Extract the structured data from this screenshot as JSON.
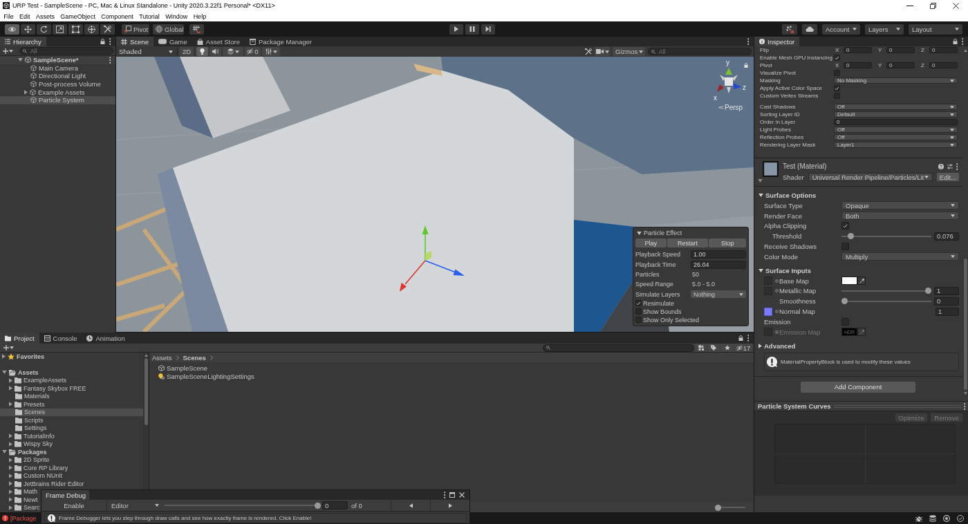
{
  "window": {
    "title": "URP Test - SampleScene - PC, Mac & Linux Standalone - Unity 2020.3.22f1 Personal* <DX11>"
  },
  "menu": [
    "File",
    "Edit",
    "Assets",
    "GameObject",
    "Component",
    "Tutorial",
    "Window",
    "Help"
  ],
  "toolbar": {
    "tools": [
      {
        "kind": "view",
        "selected": true
      },
      {
        "kind": "move",
        "selected": false
      },
      {
        "kind": "rotate",
        "selected": false
      },
      {
        "kind": "scale",
        "selected": false
      },
      {
        "kind": "rect",
        "selected": false
      },
      {
        "kind": "transform",
        "selected": false
      },
      {
        "kind": "custom",
        "selected": false
      }
    ],
    "handle_position": "Pivot",
    "handle_rotation": "Global",
    "account": "Account",
    "layers": "Layers",
    "layout": "Layout"
  },
  "hierarchy": {
    "tab": "Hierarchy",
    "search": {
      "placeholder": "All"
    },
    "items": [
      {
        "name": "SampleScene*",
        "kind": "scene",
        "expanded": true,
        "selected": false,
        "children": [
          {
            "name": "Main Camera",
            "kind": "object",
            "selected": false
          },
          {
            "name": "Directional Light",
            "kind": "object",
            "selected": false
          },
          {
            "name": "Post-process Volume",
            "kind": "object",
            "selected": false
          },
          {
            "name": "Example Assets",
            "kind": "object",
            "expanded": false,
            "selected": false
          },
          {
            "name": "Particle System",
            "kind": "object",
            "selected": true
          }
        ]
      }
    ]
  },
  "scene_view": {
    "tabs": [
      {
        "label": "Scene",
        "kind": "scene",
        "selected": true
      },
      {
        "label": "Game",
        "kind": "game",
        "selected": false
      },
      {
        "label": "Asset Store",
        "kind": "store",
        "selected": false
      },
      {
        "label": "Package Manager",
        "kind": "packages",
        "selected": false
      }
    ],
    "shading": "Shaded",
    "mode_2d": "2D",
    "toggles": [
      {
        "kind": "lighting",
        "on": true
      },
      {
        "kind": "audio",
        "on": false
      },
      {
        "kind": "effects",
        "on": false
      }
    ],
    "hidden_count": "0",
    "gizmos": "Gizmos",
    "search": {
      "placeholder": "All"
    },
    "orientation": {
      "y_label": "y",
      "x_label": "x",
      "z_label": "z",
      "projection": "Persp"
    },
    "particle_effect": {
      "title": "Particle Effect",
      "expanded": true,
      "buttons": [
        "Play",
        "Restart",
        "Stop"
      ],
      "fields": [
        {
          "kind": "input",
          "label": "Playback Speed",
          "value": "1.00"
        },
        {
          "kind": "input",
          "label": "Playback Time",
          "value": "26.04"
        },
        {
          "kind": "text",
          "label": "Particles",
          "value": "50"
        },
        {
          "kind": "text",
          "label": "Speed Range",
          "value": "5.0 - 5.0"
        },
        {
          "kind": "dropdown",
          "label": "Simulate Layers",
          "value": "Nothing"
        }
      ],
      "options": [
        {
          "label": "Resimulate",
          "checked": true
        },
        {
          "label": "Show Bounds",
          "checked": false
        },
        {
          "label": "Show Only Selected",
          "checked": false
        }
      ]
    }
  },
  "inspector": {
    "tab": "Inspector",
    "sections": [
      {
        "rows": [
          {
            "kind": "vector",
            "label": "Flip",
            "axes": [
              {
                "axis": "X",
                "value": "0"
              },
              {
                "axis": "Y",
                "value": "0"
              },
              {
                "axis": "Z",
                "value": "0"
              }
            ]
          },
          {
            "kind": "checkbox",
            "label": "Enable Mesh GPU Instancing",
            "checked": true
          },
          {
            "kind": "vector",
            "label": "Pivot",
            "axes": [
              {
                "axis": "X",
                "value": "0"
              },
              {
                "axis": "Y",
                "value": "0"
              },
              {
                "axis": "Z",
                "value": "0"
              }
            ]
          },
          {
            "kind": "checkbox",
            "label": "Visualize Pivot",
            "checked": false
          },
          {
            "kind": "dropdown",
            "label": "Masking",
            "value": "No Masking"
          },
          {
            "kind": "checkbox",
            "label": "Apply Active Color Space",
            "checked": true
          },
          {
            "kind": "checkbox",
            "label": "Custom Vertex Streams",
            "checked": false
          }
        ]
      },
      {
        "rows": [
          {
            "kind": "dropdown",
            "label": "Cast Shadows",
            "value": "Off"
          },
          {
            "kind": "dropdown",
            "label": "Sorting Layer ID",
            "value": "Default"
          },
          {
            "kind": "input",
            "label": "Order in Layer",
            "value": "0"
          },
          {
            "kind": "dropdown",
            "label": "Light Probes",
            "value": "Off"
          },
          {
            "kind": "dropdown",
            "label": "Reflection Probes",
            "value": "Off"
          },
          {
            "kind": "dropdown",
            "label": "Rendering Layer Mask",
            "value": "Layer1"
          }
        ]
      }
    ],
    "material": {
      "name": "Test (Material)",
      "shader_label": "Shader",
      "shader": "Universal Render Pipeline/Particles/Lit",
      "edit_button": "Edit...",
      "groups": [
        {
          "title": "Surface Options",
          "expanded": true,
          "rows": [
            {
              "kind": "dropdown",
              "label": "Surface Type",
              "value": "Opaque"
            },
            {
              "kind": "dropdown",
              "label": "Render Face",
              "value": "Both"
            },
            {
              "kind": "checkbox",
              "label": "Alpha Clipping",
              "checked": true,
              "children": [
                {
                  "kind": "slider",
                  "label": "Threshold",
                  "level": 0.076,
                  "value": "0.076"
                }
              ]
            },
            {
              "kind": "checkbox",
              "label": "Receive Shadows",
              "checked": false
            },
            {
              "kind": "dropdown",
              "label": "Color Mode",
              "value": "Multiply"
            }
          ]
        },
        {
          "title": "Surface Inputs",
          "expanded": true,
          "rows": [
            {
              "kind": "texture_color",
              "label": "Base Map",
              "texture_assigned": false,
              "color": "#ffffff",
              "disabled": false
            },
            {
              "kind": "texture_slider",
              "label": "Metallic Map",
              "texture_assigned": false,
              "level": 1,
              "value": "1",
              "disabled": false,
              "children": [
                {
                  "kind": "slider",
                  "label": "Smoothness",
                  "level": 0,
                  "value": "0",
                  "disabled": false
                }
              ]
            },
            {
              "kind": "texture_value",
              "label": "Normal Map",
              "texture_assigned": true,
              "value": "1",
              "disabled": false
            },
            {
              "kind": "checkbox",
              "label": "Emission",
              "checked": false,
              "disabled": false
            },
            {
              "kind": "texture_hdr",
              "label": "Emission Map",
              "texture_assigned": false,
              "color": "#000000",
              "badge": "HDR",
              "disabled": true
            }
          ]
        },
        {
          "title": "Advanced",
          "expanded": false
        }
      ]
    },
    "info": "MaterialPropertyBlock is used to modify these values",
    "add_component": "Add Component",
    "curves": {
      "title": "Particle System Curves",
      "buttons": [
        {
          "label": "Optimize",
          "disabled": true
        },
        {
          "label": "Remove",
          "disabled": true
        }
      ]
    }
  },
  "project": {
    "tabs": [
      {
        "label": "Project",
        "kind": "project",
        "selected": true
      },
      {
        "label": "Console",
        "kind": "console",
        "selected": false
      },
      {
        "label": "Animation",
        "kind": "animation",
        "selected": false
      }
    ],
    "hidden_count": "17",
    "tree": [
      {
        "name": "Favorites",
        "kind": "favorites",
        "expanded": false,
        "selected": false
      },
      {
        "name": "Assets",
        "kind": "root",
        "expanded": true,
        "selected": false,
        "children": [
          {
            "name": "ExampleAssets",
            "kind": "folder",
            "expanded": false,
            "selected": false
          },
          {
            "name": "Fantasy Skybox FREE",
            "kind": "folder",
            "expanded": false,
            "selected": false
          },
          {
            "name": "Materials",
            "kind": "folder",
            "selected": false
          },
          {
            "name": "Presets",
            "kind": "folder",
            "expanded": false,
            "selected": false
          },
          {
            "name": "Scenes",
            "kind": "folder",
            "selected": true
          },
          {
            "name": "Scripts",
            "kind": "folder",
            "selected": false
          },
          {
            "name": "Settings",
            "kind": "folder",
            "selected": false
          },
          {
            "name": "TutorialInfo",
            "kind": "folder",
            "expanded": false,
            "selected": false
          },
          {
            "name": "Wispy Sky",
            "kind": "folder",
            "expanded": false,
            "selected": false
          }
        ]
      },
      {
        "name": "Packages",
        "kind": "root",
        "expanded": true,
        "selected": false,
        "children": [
          {
            "name": "2D Sprite",
            "kind": "folder",
            "expanded": false,
            "selected": false
          },
          {
            "name": "Core RP Library",
            "kind": "folder",
            "expanded": false,
            "selected": false
          },
          {
            "name": "Custom NUnit",
            "kind": "folder",
            "expanded": false,
            "selected": false
          },
          {
            "name": "JetBrains Rider Editor",
            "kind": "folder",
            "expanded": false,
            "selected": false
          },
          {
            "name": "Math",
            "kind": "folder",
            "expanded": false,
            "selected": false
          },
          {
            "name": "Newt",
            "kind": "folder",
            "expanded": false,
            "selected": false
          },
          {
            "name": "Searc",
            "kind": "folder",
            "expanded": false,
            "selected": false
          }
        ]
      }
    ],
    "breadcrumb": [
      "Assets",
      "Scenes"
    ],
    "files": [
      {
        "name": "SampleScene",
        "kind": "scene"
      },
      {
        "name": "SampleSceneLightingSettings",
        "kind": "lighting"
      }
    ],
    "icon_size": {
      "level": 0
    }
  },
  "frame_debug": {
    "title": "Frame Debug",
    "enable_button": "Enable",
    "target": "Editor",
    "level": 1,
    "event": "0",
    "total": "of 0",
    "message": "Frame Debugger lets you step through draw calls and see how exactly frame is rendered. Click Enable!"
  },
  "status_bar": {
    "kind": "error",
    "message": "[Package"
  }
}
